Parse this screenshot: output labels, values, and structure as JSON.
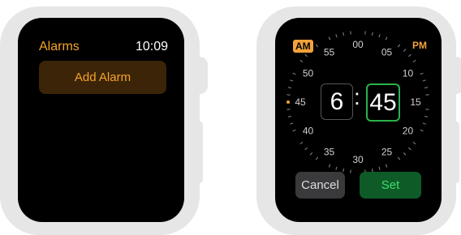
{
  "alarms_screen": {
    "title": "Alarms",
    "time": "10:09",
    "add_alarm_label": "Add Alarm"
  },
  "time_picker": {
    "am_label": "AM",
    "pm_label": "PM",
    "hour": "6",
    "separator": ":",
    "minute": "45",
    "selected_period": "AM",
    "dial_labels": [
      "00",
      "05",
      "10",
      "15",
      "20",
      "25",
      "30",
      "35",
      "40",
      "45",
      "50",
      "55"
    ],
    "cancel_label": "Cancel",
    "set_label": "Set"
  },
  "colors": {
    "accent_orange": "#f4a42a",
    "set_green": "#2bb24a",
    "screen_bg": "#000000",
    "watch_body": "#e6e6e6"
  }
}
